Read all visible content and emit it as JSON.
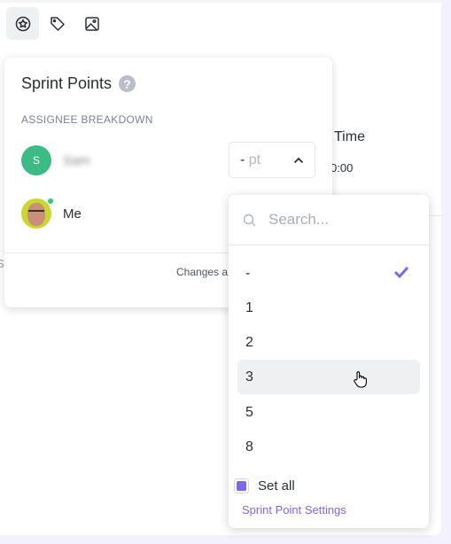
{
  "toolbar": {
    "icons": [
      "sprint-points-icon",
      "tag-icon",
      "image-icon"
    ]
  },
  "background": {
    "time_label": "Time",
    "time_value": "0:00",
    "left_fragment": "S"
  },
  "popover": {
    "title": "Sprint Points",
    "section": "ASSIGNEE BREAKDOWN",
    "assignees": [
      {
        "initial": "S",
        "name": "Sam",
        "avatar_color": "#3dbb84",
        "points": "-",
        "unit": "pt"
      },
      {
        "name": "Me",
        "online": true
      }
    ],
    "footer": "Changes a"
  },
  "dropdown": {
    "search_placeholder": "Search...",
    "options": [
      "-",
      "1",
      "2",
      "3",
      "5",
      "8"
    ],
    "selected": "-",
    "hovered": "3",
    "set_all_label": "Set all",
    "set_all_checked": true,
    "settings_link": "Sprint Point Settings"
  },
  "colors": {
    "accent": "#7b68ee",
    "online": "#2ecd6f"
  }
}
